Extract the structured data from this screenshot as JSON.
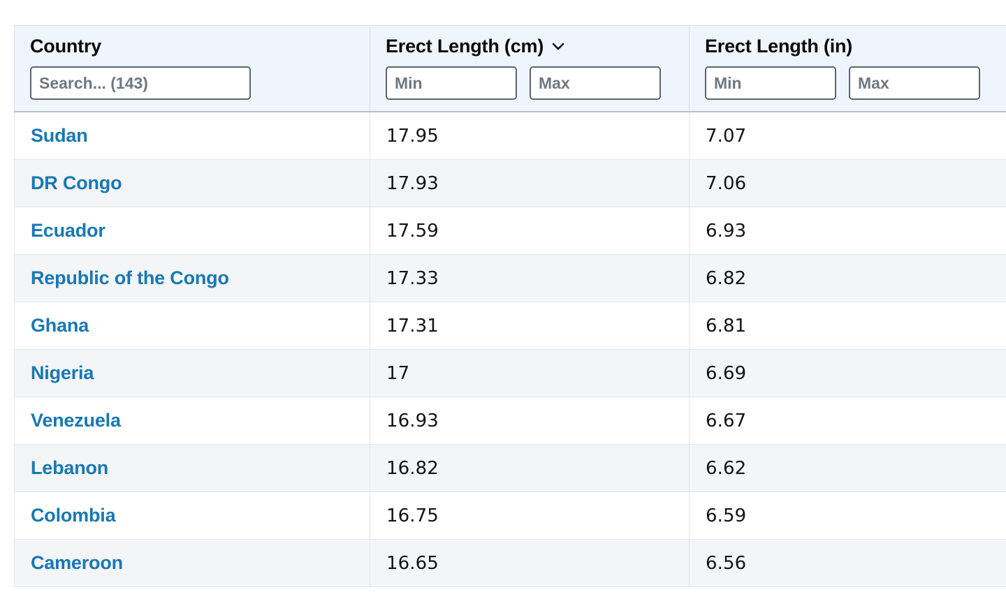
{
  "table": {
    "columns": [
      {
        "key": "country",
        "label": "Country",
        "sorted": false,
        "sort_icon": "",
        "filters": [
          {
            "name": "search",
            "placeholder": "Search... (143)",
            "value": ""
          }
        ]
      },
      {
        "key": "erect_length_cm",
        "label": "Erect Length (cm)",
        "sorted": true,
        "sort_icon": "chevron-down-icon",
        "filters": [
          {
            "name": "min",
            "placeholder": "Min",
            "value": ""
          },
          {
            "name": "max",
            "placeholder": "Max",
            "value": ""
          }
        ]
      },
      {
        "key": "erect_length_in",
        "label": "Erect Length (in)",
        "sorted": false,
        "sort_icon": "",
        "filters": [
          {
            "name": "min",
            "placeholder": "Min",
            "value": ""
          },
          {
            "name": "max",
            "placeholder": "Max",
            "value": ""
          }
        ]
      }
    ],
    "rows": [
      {
        "country": "Sudan",
        "cm": "17.95",
        "in": "7.07"
      },
      {
        "country": "DR Congo",
        "cm": "17.93",
        "in": "7.06"
      },
      {
        "country": "Ecuador",
        "cm": "17.59",
        "in": "6.93"
      },
      {
        "country": "Republic of the Congo",
        "cm": "17.33",
        "in": "6.82"
      },
      {
        "country": "Ghana",
        "cm": "17.31",
        "in": "6.81"
      },
      {
        "country": "Nigeria",
        "cm": "17",
        "in": "6.69"
      },
      {
        "country": "Venezuela",
        "cm": "16.93",
        "in": "6.67"
      },
      {
        "country": "Lebanon",
        "cm": "16.82",
        "in": "6.62"
      },
      {
        "country": "Colombia",
        "cm": "16.75",
        "in": "6.59"
      },
      {
        "country": "Cameroon",
        "cm": "16.65",
        "in": "6.56"
      }
    ],
    "total_count": "143",
    "colors": {
      "link": "#1878b4",
      "header_bg": "#eff5fc",
      "row_stripe": "#f3f5f7",
      "row_base": "#ffffff",
      "border": "#e3e6ea",
      "header_border": "#b6bfc8",
      "input_border": "#5a6570",
      "placeholder": "#6e7881",
      "value_text": "#141414"
    }
  }
}
